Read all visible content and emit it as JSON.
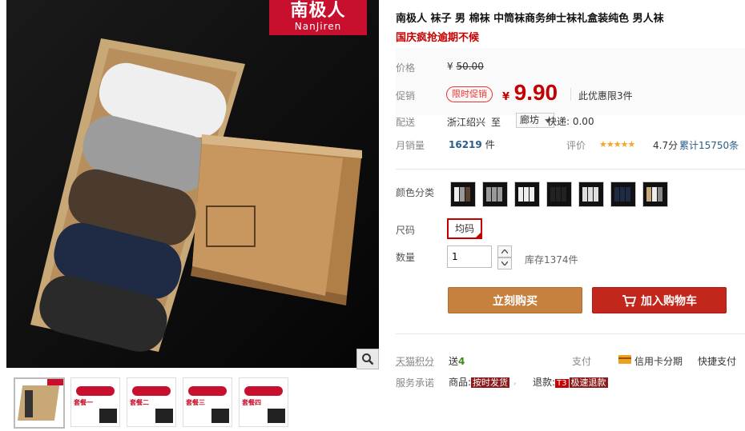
{
  "brand_logo": {
    "cn": "南极人",
    "en": "NanJiren"
  },
  "product": {
    "title": "南极人 袜子 男 棉袜 中筒袜商务绅士袜礼盒装纯色 男人袜",
    "promo_text": "国庆疯抢逾期不候"
  },
  "price": {
    "label": "价格",
    "currency": "¥",
    "original": "50.00"
  },
  "promo": {
    "label": "促销",
    "badge": "限时促销",
    "currency": "¥",
    "price": "9.90",
    "limit": "此优惠限3件"
  },
  "shipping": {
    "label": "配送",
    "from": "浙江绍兴",
    "to_word": "至",
    "dest": "廊坊",
    "fee": "快递: 0.00"
  },
  "sales": {
    "label": "月销量",
    "count": "16219",
    "unit": "件",
    "rating_label": "评价",
    "stars": "★★★★★",
    "score": "4.7分",
    "total": "累计15750条"
  },
  "color": {
    "label": "颜色分类"
  },
  "size": {
    "label": "尺码",
    "value": "均码"
  },
  "quantity": {
    "label": "数量",
    "value": "1",
    "stock": "库存1374件"
  },
  "actions": {
    "buy": "立刻购买",
    "cart": "加入购物车"
  },
  "points": {
    "label": "天猫积分",
    "prefix": "送",
    "value": "4",
    "pay_label": "支付",
    "installment": "信用卡分期",
    "quick_pay": "快捷支付"
  },
  "service": {
    "label": "服务承诺",
    "goods_prefix": "商品:",
    "goods_tag": "按时发货",
    "refund_prefix": "退款:",
    "refund_t3": "T3",
    "refund_tag": "极速退款"
  },
  "thumbnails": [
    {
      "text": ""
    },
    {
      "text": "套餐一"
    },
    {
      "text": "套餐二"
    },
    {
      "text": "套餐三"
    },
    {
      "text": "套餐四"
    }
  ],
  "colors": {
    "brand_red": "#c8102e",
    "price_red": "#c40000",
    "buy_orange": "#c7813e",
    "cart_red": "#c3261b"
  }
}
